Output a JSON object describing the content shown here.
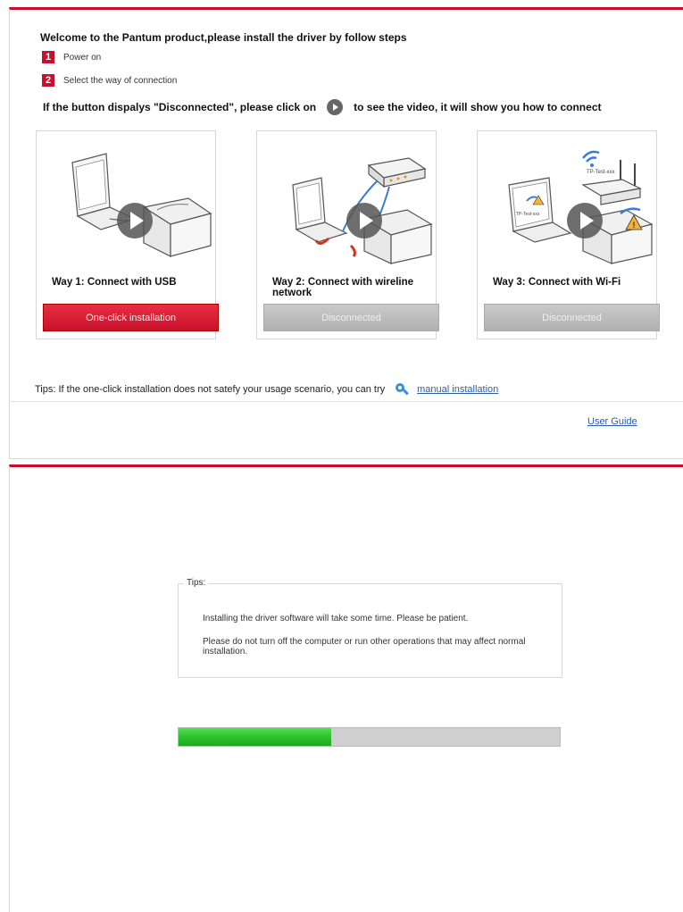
{
  "installer": {
    "welcome": "Welcome to the Pantum product,please install the driver by follow steps",
    "steps": [
      {
        "num": "1",
        "label": "Power on"
      },
      {
        "num": "2",
        "label": "Select the way of connection"
      }
    ],
    "hint_before": "If the button dispalys \"Disconnected\", please click on",
    "hint_after": "to see the video, it will show you how to connect",
    "ways": [
      {
        "label": "Way 1: Connect with USB",
        "button": "One-click installation",
        "state": "active"
      },
      {
        "label": "Way 2: Connect with wireline network",
        "button": "Disconnected",
        "state": "disabled"
      },
      {
        "label": "Way 3: Connect with Wi-Fi",
        "button": "Disconnected",
        "state": "disabled"
      }
    ],
    "tips_text": "Tips: If the one-click installation does not satefy your usage scenario, you can try",
    "manual_link": "manual installation",
    "user_guide": "User Guide",
    "wifi_ssid": "TP-Test-xxx"
  },
  "progress_panel": {
    "tips_title": "Tips:",
    "messages": [
      "Installing the driver software will take some time. Please be patient.",
      "Please do not turn off the computer or run other operations that may affect normal installation."
    ],
    "progress": 0.4
  },
  "colors": {
    "accent": "#c8102e",
    "progress": "#2bc22b",
    "link": "#2a5db0"
  }
}
